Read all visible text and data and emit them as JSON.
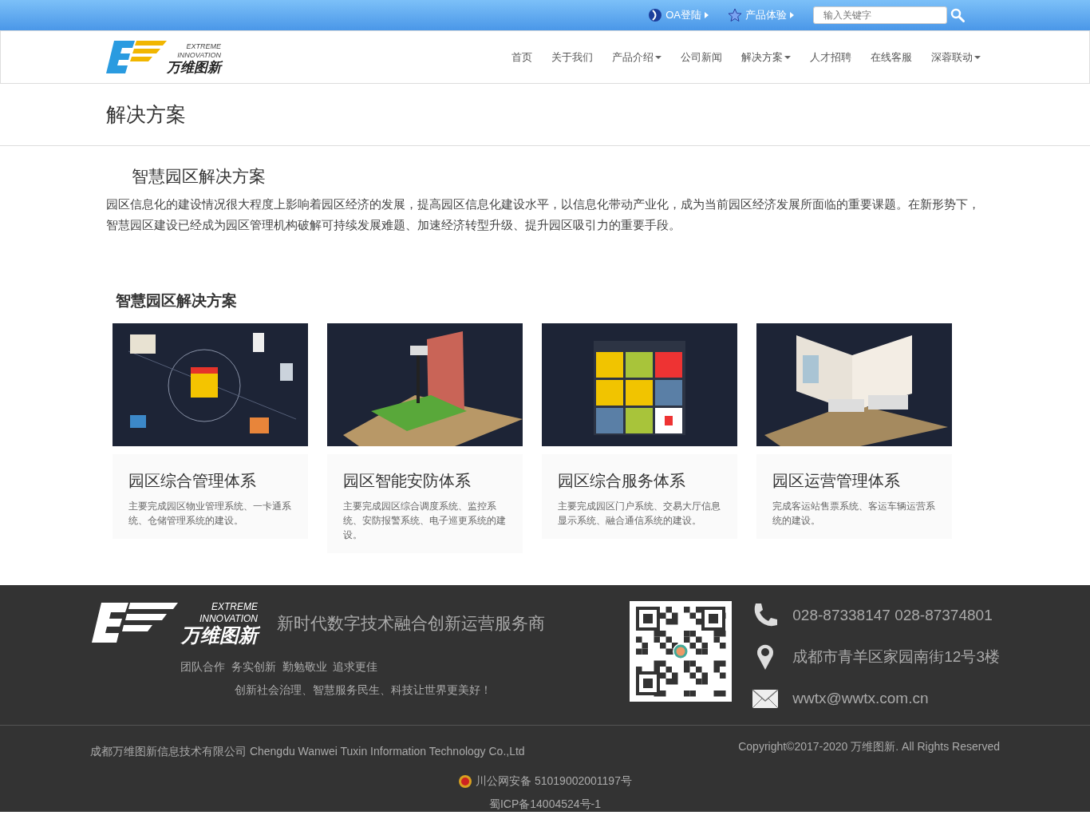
{
  "topbar": {
    "links": [
      {
        "label": "OA登陆",
        "kind": "oa"
      },
      {
        "label": "产品体验",
        "kind": "star"
      }
    ],
    "search": {
      "placeholder": "输入关键字"
    }
  },
  "header": {
    "logo": {
      "en_line_1": "EXTREME",
      "en_line_2": "INNOVATION",
      "cn": "万维图新"
    },
    "nav": [
      {
        "label": "首页",
        "dropdown": false
      },
      {
        "label": "关于我们",
        "dropdown": false
      },
      {
        "label": "产品介绍",
        "dropdown": true
      },
      {
        "label": "公司新闻",
        "dropdown": false
      },
      {
        "label": "解决方案",
        "dropdown": true
      },
      {
        "label": "人才招聘",
        "dropdown": false
      },
      {
        "label": "在线客服",
        "dropdown": false
      },
      {
        "label": "深蓉联动",
        "dropdown": true
      }
    ]
  },
  "page_title": "解决方案",
  "article": {
    "title": "智慧园区解决方案",
    "intro": "园区信息化的建设情况很大程度上影响着园区经济的发展，提高园区信息化建设水平，以信息化带动产业化，成为当前园区经济发展所面临的重要课题。在新形势下，智慧园区建设已经成为园区管理机构破解可持续发展难题、加速经济转型升级、提升园区吸引力的重要手段。"
  },
  "section_title": "智慧园区解决方案",
  "cards": [
    {
      "kind": "network",
      "title": "园区综合管理体系",
      "text": "主要完成园区物业管理系统、一卡通系统、仓储管理系统的建设。"
    },
    {
      "kind": "camera",
      "title": "园区智能安防体系",
      "text": "主要完成园区综合调度系统、监控系统、安防报警系统、电子巡更系统的建设。"
    },
    {
      "kind": "cube",
      "title": "园区综合服务体系",
      "text": "主要完成园区门户系统、交易大厅信息显示系统、融合通信系统的建设。"
    },
    {
      "kind": "room",
      "title": "园区运营管理体系",
      "text": "完成客运站售票系统、客运车辆运营系统的建设。"
    }
  ],
  "footer": {
    "logo": {
      "en_line_1": "EXTREME",
      "en_line_2": "INNOVATION",
      "cn": "万维图新"
    },
    "slogan": "新时代数字技术融合创新运营服务商",
    "values": "团队合作  务实创新  勤勉敬业  追求更佳",
    "mission": "创新社会治理、智慧服务民生、科技让世界更美好！",
    "contacts": [
      {
        "kind": "phone",
        "text": "028-87338147 028-87374801"
      },
      {
        "kind": "pin",
        "text": "成都市青羊区家园南街12号3楼"
      },
      {
        "kind": "mail",
        "text": "wwtx@wwtx.com.cn"
      }
    ],
    "company": "成都万维图新信息技术有限公司 Chengdu Wanwei Tuxin Information Technology Co.,Ltd",
    "copyright": "Copyright©2017-2020 万维图新. All Rights Reserved",
    "police_record": "川公网安备 51019002001197号",
    "icp": "蜀ICP备14004524号-1"
  }
}
